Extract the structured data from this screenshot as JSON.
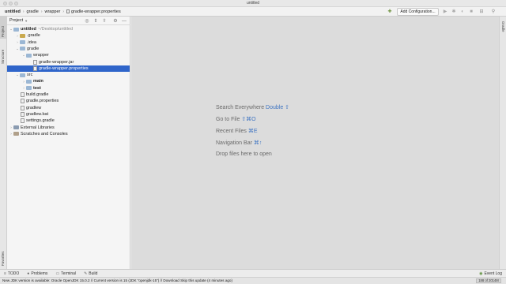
{
  "window": {
    "title": "untitled"
  },
  "breadcrumbs": [
    "untitled",
    "gradle",
    "wrapper",
    "gradle-wrapper.properties"
  ],
  "toolbar": {
    "add_config_label": "Add Configuration..."
  },
  "left_strip": {
    "project_tab": "Project",
    "structure_tab": "Structure",
    "favorites_tab": "Favorites"
  },
  "right_strip": {
    "gradle_tab": "Gradle"
  },
  "project_panel": {
    "title": "Project",
    "tree": [
      {
        "label": "untitled",
        "suffix": "~/Desktop/untitled",
        "depth": 0,
        "expanded": true,
        "kind": "folder",
        "bold": true
      },
      {
        "label": ".gradle",
        "depth": 1,
        "expanded": false,
        "kind": "folder-excluded"
      },
      {
        "label": ".idea",
        "depth": 1,
        "expanded": false,
        "kind": "folder"
      },
      {
        "label": "gradle",
        "depth": 1,
        "expanded": true,
        "kind": "folder"
      },
      {
        "label": "wrapper",
        "depth": 2,
        "expanded": true,
        "kind": "folder"
      },
      {
        "label": "gradle-wrapper.jar",
        "depth": 3,
        "kind": "file"
      },
      {
        "label": "gradle-wrapper.properties",
        "depth": 3,
        "kind": "file",
        "selected": true
      },
      {
        "label": "src",
        "depth": 1,
        "expanded": true,
        "kind": "folder"
      },
      {
        "label": "main",
        "depth": 2,
        "expanded": false,
        "kind": "folder",
        "bold": true
      },
      {
        "label": "test",
        "depth": 2,
        "expanded": false,
        "kind": "folder",
        "bold": true
      },
      {
        "label": "build.gradle",
        "depth": 1,
        "kind": "file"
      },
      {
        "label": "gradle.properties",
        "depth": 1,
        "kind": "file"
      },
      {
        "label": "gradlew",
        "depth": 1,
        "kind": "file"
      },
      {
        "label": "gradlew.bat",
        "depth": 1,
        "kind": "file"
      },
      {
        "label": "settings.gradle",
        "depth": 1,
        "kind": "file"
      },
      {
        "label": "External Libraries",
        "depth": 0,
        "expanded": false,
        "kind": "library"
      },
      {
        "label": "Scratches and Consoles",
        "depth": 0,
        "expanded": false,
        "kind": "scratch"
      }
    ]
  },
  "editor_hints": [
    {
      "text": "Search Everywhere",
      "key": "Double ⇧"
    },
    {
      "text": "Go to File",
      "key": "⇧⌘O"
    },
    {
      "text": "Recent Files",
      "key": "⌘E"
    },
    {
      "text": "Navigation Bar",
      "key": "⌘↑"
    },
    {
      "text": "Drop files here to open",
      "key": ""
    }
  ],
  "bottom_tabs": {
    "todo": "TODO",
    "problems": "Problems",
    "terminal": "Terminal",
    "build": "Build",
    "event_log": "Event Log"
  },
  "status": {
    "message": "New JDK version is available: Oracle OpenJDK 15.0.2 // Current version is 15 (JDK \"openjdk-15\") // Download   Skip this update (4 minutes ago)",
    "memory": "188 of 2014M"
  },
  "colors": {
    "selection": "#2f65ca",
    "accent": "#3e74c2"
  }
}
